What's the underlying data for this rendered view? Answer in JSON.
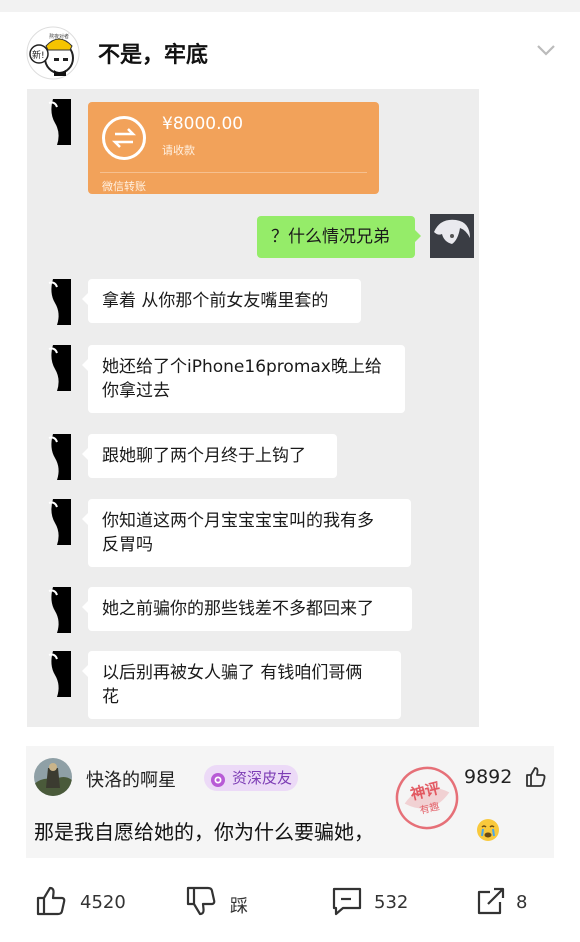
{
  "post": {
    "title": "不是，牢底",
    "avatar_text": "新!",
    "avatar_caption": "熬夜对者"
  },
  "chat": {
    "transfer": {
      "amount": "¥8000.00",
      "status": "请收款",
      "label": "微信转账"
    },
    "self_message": "？什么情况兄弟",
    "messages": [
      {
        "lines": [
          "拿着 从你那个前女友嘴里套的"
        ]
      },
      {
        "lines": [
          "她还给了个iPhone16promax晚上给",
          "你拿过去"
        ]
      },
      {
        "lines": [
          "跟她聊了两个月终于上钩了"
        ]
      },
      {
        "lines": [
          "你知道这两个月宝宝宝宝叫的我有多",
          "反胃吗"
        ]
      },
      {
        "lines": [
          "她之前骗你的那些钱差不多都回来了"
        ]
      },
      {
        "lines": [
          "以后别再被女人骗了 有钱咱们哥俩",
          "花"
        ]
      }
    ]
  },
  "comment": {
    "username": "快洛的啊星",
    "badge": "资深皮友",
    "likes": "9892",
    "text": "那是我自愿给她的，你为什么要骗她，",
    "stamp_text": [
      "神评",
      "有趣"
    ]
  },
  "actions": {
    "like_count": "4520",
    "dislike_label": "踩",
    "comment_count": "532",
    "share_count": "8"
  },
  "colors": {
    "transfer": "#f2a25a",
    "self_bubble": "#95ec69",
    "badge_text": "#7d3db5",
    "stamp": "#e0434d"
  }
}
